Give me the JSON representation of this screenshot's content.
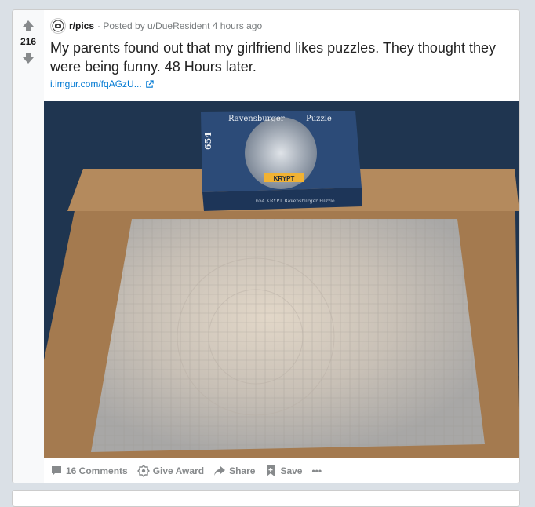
{
  "post": {
    "subreddit": "r/pics",
    "posted_by": "· Posted by u/DueResident 4 hours ago",
    "score": "216",
    "title": "My parents found out that my girlfriend likes puzzles. They thought they were being funny. 48 Hours later.",
    "link_text": "i.imgur.com/fqAGzU...",
    "image": {
      "box_brand": "Ravensburger",
      "box_word": "Puzzle",
      "box_number": "654",
      "box_label": "KRYPT",
      "box_spine": "654 KRYPT Ravensburger Puzzle"
    }
  },
  "actions": {
    "comments": "16 Comments",
    "award": "Give Award",
    "share": "Share",
    "save": "Save",
    "more": "•••"
  },
  "icons": [
    "upvote-icon",
    "downvote-icon",
    "subreddit-avatar-icon",
    "external-link-icon",
    "comment-icon",
    "award-icon",
    "share-icon",
    "save-icon",
    "more-icon"
  ],
  "colors": {
    "link": "#0079d3",
    "background": "#dae0e6",
    "muted": "#878a8c"
  }
}
